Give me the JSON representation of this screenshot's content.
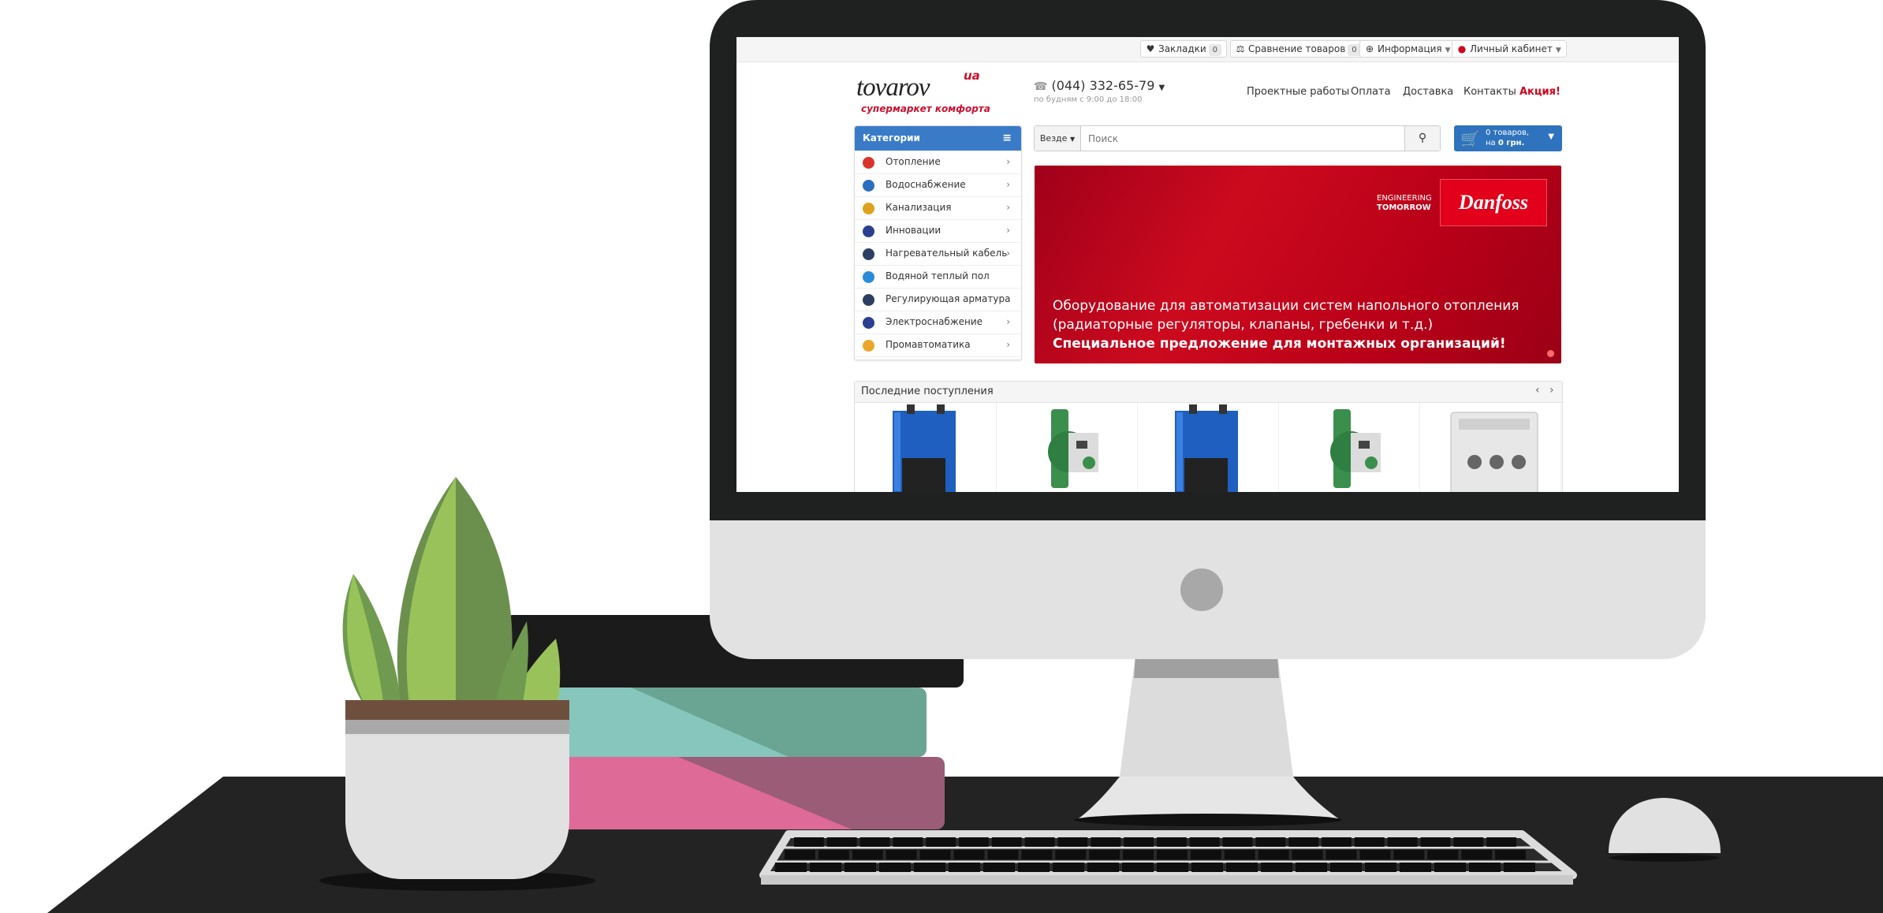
{
  "topbar": {
    "bookmarks": {
      "label": "Закладки",
      "count": "0"
    },
    "compare": {
      "label": "Сравнение товаров",
      "count": "0"
    },
    "info": {
      "label": "Информация"
    },
    "account": {
      "label": "Личный кабинет"
    }
  },
  "logo": {
    "word": "tovarov",
    "suffix": "ua",
    "slogan": "супермаркет комфорта"
  },
  "contact": {
    "phone": "(044) 332-65-79",
    "hours": "по будням с 9:00 до 18:00"
  },
  "nav": [
    "Проектные работы",
    "Оплата",
    "Доставка",
    "Контакты"
  ],
  "nav_promo": "Акция!",
  "categories": {
    "title": "Категории",
    "items": [
      {
        "label": "Отопление",
        "has_sub": true,
        "color": "#d9342b"
      },
      {
        "label": "Водоснабжение",
        "has_sub": true,
        "color": "#2a6fbd"
      },
      {
        "label": "Канализация",
        "has_sub": true,
        "color": "#e0a21c"
      },
      {
        "label": "Инновации",
        "has_sub": true,
        "color": "#2a3f8f"
      },
      {
        "label": "Нагревательный кабель",
        "has_sub": true,
        "color": "#2d3e63"
      },
      {
        "label": "Водяной теплый пол",
        "has_sub": false,
        "color": "#2a8bd8"
      },
      {
        "label": "Регулирующая арматура",
        "has_sub": false,
        "color": "#2d3e63"
      },
      {
        "label": "Электроснабжение",
        "has_sub": true,
        "color": "#2a3f8f"
      },
      {
        "label": "Промавтоматика",
        "has_sub": true,
        "color": "#e9a62a"
      }
    ]
  },
  "search": {
    "where": "Везде",
    "placeholder": "Поиск"
  },
  "cart": {
    "line1": "0 товаров,",
    "line2_prefix": "на ",
    "line2_value": "0 грн."
  },
  "banner": {
    "eng1": "ENGINEERING",
    "eng2": "TOMORROW",
    "brand": "Danfoss",
    "line1": "Оборудование для автоматизации систем напольного отопления",
    "line2": "(радиаторные регуляторы, клапаны, гребенки и т.д.)",
    "line3": "Специальное предложение для монтажных организаций!"
  },
  "latest": {
    "title": "Последние поступления",
    "products": [
      "boiler",
      "pump",
      "boiler",
      "pump",
      "thermostat"
    ]
  },
  "colors": {
    "accent": "#3a7bc8",
    "cart": "#2f73be",
    "promo": "#d0021b",
    "banner": "#c8001c"
  }
}
